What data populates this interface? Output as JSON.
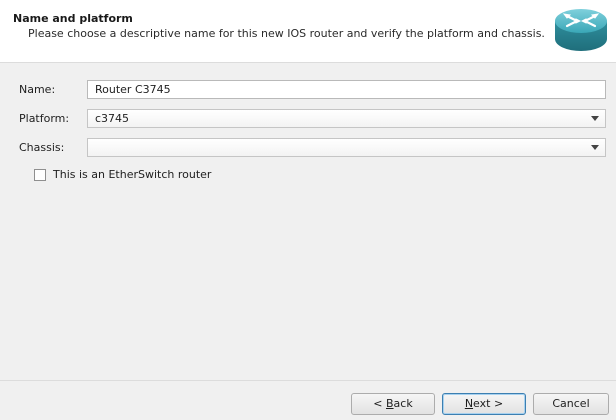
{
  "header": {
    "title": "Name and platform",
    "subtitle": "Please choose a descriptive name for this new IOS router and verify the platform and chassis.",
    "logo_icon": "router-icon"
  },
  "form": {
    "name_label": "Name:",
    "name_value": "Router C3745",
    "platform_label": "Platform:",
    "platform_value": "c3745",
    "chassis_label": "Chassis:",
    "chassis_value": "",
    "etherswitch_label": "This is an EtherSwitch router",
    "etherswitch_checked": false
  },
  "buttons": {
    "back_prefix": "< ",
    "back_mnemonic": "B",
    "back_rest": "ack",
    "next_mnemonic": "N",
    "next_rest": "ext >",
    "cancel": "Cancel"
  },
  "colors": {
    "router_teal": "#3aa7b7",
    "default_button_border": "#3c7fb1"
  }
}
